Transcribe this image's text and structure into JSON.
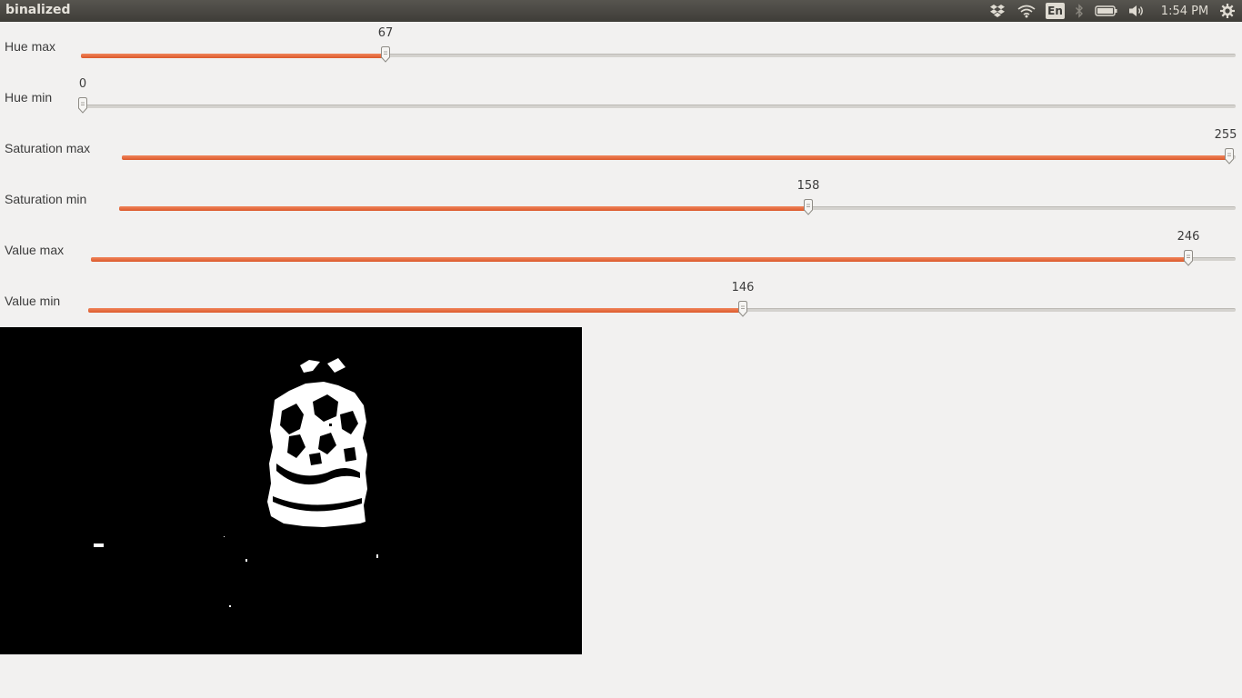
{
  "window": {
    "title": "binalized"
  },
  "tray": {
    "icons": [
      "dropbox-icon",
      "wifi-icon",
      "keyboard-layout-indicator",
      "bluetooth-icon",
      "battery-icon",
      "volume-icon",
      "clock",
      "settings-gear-icon"
    ],
    "keyboard_layout": "En",
    "clock": "1:54 PM"
  },
  "trackbars": [
    {
      "label": "Hue max",
      "value": "67",
      "max": 255
    },
    {
      "label": "Hue min",
      "value": "0",
      "max": 255
    },
    {
      "label": "Saturation max",
      "value": "255",
      "max": 255
    },
    {
      "label": "Saturation min",
      "value": "158",
      "max": 255
    },
    {
      "label": "Value max",
      "value": "246",
      "max": 255
    },
    {
      "label": "Value min",
      "value": "146",
      "max": 255
    }
  ],
  "colors": {
    "slider_fill": "#e55b2d",
    "panel_bg": "#3c3b37",
    "window_bg": "#f2f1f0"
  },
  "image": {
    "description": "binary thresholded camera frame"
  }
}
